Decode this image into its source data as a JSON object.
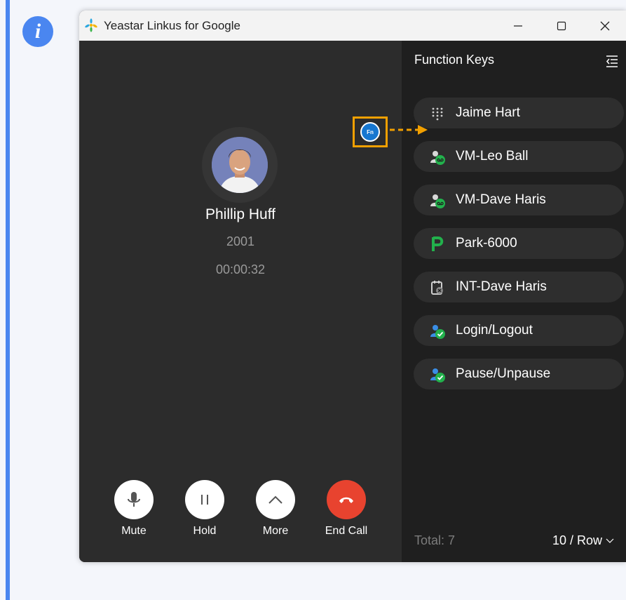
{
  "window": {
    "title": "Yeastar Linkus for Google"
  },
  "call": {
    "caller_name": "Phillip Huff",
    "caller_ext": "2001",
    "duration": "00:00:32",
    "controls": [
      {
        "label": "Mute",
        "icon": "microphone-icon"
      },
      {
        "label": "Hold",
        "icon": "pause-icon"
      },
      {
        "label": "More",
        "icon": "chevron-up-icon"
      },
      {
        "label": "End Call",
        "icon": "hang-up-icon"
      }
    ]
  },
  "function_keys": {
    "title": "Function Keys",
    "items": [
      {
        "label": "Jaime Hart",
        "icon": "keypad-icon"
      },
      {
        "label": "VM-Leo Ball",
        "icon": "voicemail-icon"
      },
      {
        "label": "VM-Dave Haris",
        "icon": "voicemail-icon"
      },
      {
        "label": "Park-6000",
        "icon": "park-icon"
      },
      {
        "label": "INT-Dave Haris",
        "icon": "intercom-icon"
      },
      {
        "label": "Login/Logout",
        "icon": "agent-status-icon"
      },
      {
        "label": "Pause/Unpause",
        "icon": "agent-status-icon"
      }
    ],
    "total": "Total: 7",
    "per_page": "10 / Row",
    "badge_text": "Fn"
  },
  "colors": {
    "info_blue": "#4a86f0",
    "highlight_orange": "#f2a000",
    "end_call_red": "#e8432f",
    "status_green": "#22b14c"
  }
}
